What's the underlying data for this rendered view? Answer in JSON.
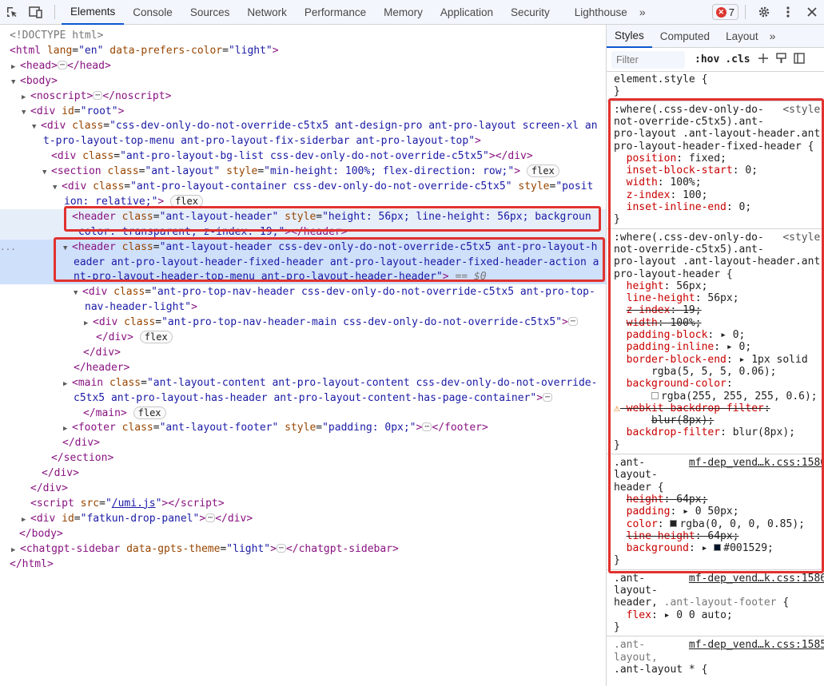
{
  "toolbar": {
    "tabs": [
      "Elements",
      "Console",
      "Sources",
      "Network",
      "Performance",
      "Memory",
      "Application",
      "Security",
      "Lighthouse"
    ],
    "more": "»",
    "error_count": "7",
    "icons": [
      "inspect-icon",
      "device-toggle-icon",
      "settings-icon",
      "kebab-menu-icon",
      "close-icon"
    ]
  },
  "dom": {
    "lines": [
      {
        "indent": 0,
        "tri": "",
        "html": "<span class=\"gray\">&lt;!DOCTYPE html&gt;</span>"
      },
      {
        "indent": 0,
        "tri": "",
        "html": "<span class=\"tag\">&lt;html</span> <span class=\"attr\">lang</span>=<span class=\"val\">\"en\"</span> <span class=\"attr\">data-prefers-color</span>=<span class=\"val\">\"light\"</span><span class=\"tag\">&gt;</span>"
      },
      {
        "indent": 1,
        "tri": "▶",
        "html": "<span class=\"tag\">&lt;head&gt;</span><span class=\"dots\">⋯</span><span class=\"tag\">&lt;/head&gt;</span>"
      },
      {
        "indent": 1,
        "tri": "▼",
        "html": "<span class=\"tag\">&lt;body&gt;</span>"
      },
      {
        "indent": 2,
        "tri": "▶",
        "html": "<span class=\"tag\">&lt;noscript&gt;</span><span class=\"dots\">⋯</span><span class=\"tag\">&lt;/noscript&gt;</span>"
      },
      {
        "indent": 2,
        "tri": "▼",
        "html": "<span class=\"tag\">&lt;div</span> <span class=\"attr\">id</span>=<span class=\"val\">\"root\"</span><span class=\"tag\">&gt;</span>"
      },
      {
        "indent": 3,
        "tri": "▼",
        "html": "<span class=\"tag\">&lt;div</span> <span class=\"attr\">class</span>=<span class=\"val\">\"css-dev-only-do-not-override-c5tx5 ant-design-pro ant-pro-layout screen-xl an</span>"
      },
      {
        "indent": 3,
        "tri": "",
        "raw_indent": 54,
        "html": "<span class=\"val\">t-pro-layout-top-menu ant-pro-layout-fix-siderbar ant-pro-layout-top\"</span><span class=\"tag\">&gt;</span>"
      },
      {
        "indent": 4,
        "tri": "",
        "html": "<span class=\"tag\">&lt;div</span> <span class=\"attr\">class</span>=<span class=\"val\">\"ant-pro-layout-bg-list css-dev-only-do-not-override-c5tx5\"</span><span class=\"tag\">&gt;&lt;/div&gt;</span>"
      },
      {
        "indent": 4,
        "tri": "▼",
        "html": "<span class=\"tag\">&lt;section</span> <span class=\"attr\">class</span>=<span class=\"val\">\"ant-layout\"</span> <span class=\"attr\">style</span>=<span class=\"val\">\"min-height: 100%; flex-direction: row;\"</span><span class=\"tag\">&gt;</span> <span class=\"pill\">flex</span>"
      },
      {
        "indent": 5,
        "tri": "▼",
        "html": "<span class=\"tag\">&lt;div</span> <span class=\"attr\">class</span>=<span class=\"val\">\"ant-pro-layout-container css-dev-only-do-not-override-c5tx5\"</span> <span class=\"attr\">style</span>=<span class=\"val\">\"posit</span>"
      },
      {
        "indent": 5,
        "tri": "",
        "raw_indent": 80,
        "html": "<span class=\"val\">ion: relative;\"</span><span class=\"tag\">&gt;</span> <span class=\"pill\">flex</span>"
      },
      {
        "indent": 6,
        "tri": "",
        "hov": true,
        "html": "<span class=\"tag\">&lt;header</span> <span class=\"attr\">class</span>=<span class=\"val\">\"ant-layout-header\"</span> <span class=\"attr\">style</span>=<span class=\"val\">\"height: 56px; line-height: 56px; backgroun</span>"
      },
      {
        "indent": 6,
        "tri": "",
        "hov": true,
        "raw_indent": 98,
        "html": "<span class=\"val\">color: transparent; z-index: 19;\"</span><span class=\"tag\">&gt;&lt;/header&gt;</span>"
      },
      {
        "indent": 6,
        "tri": "▼",
        "sel": true,
        "html": "<span class=\"tag\">&lt;header</span> <span class=\"attr\">class</span>=<span class=\"val\">\"ant-layout-header css-dev-only-do-not-override-c5tx5 ant-pro-layout-h</span>"
      },
      {
        "indent": 6,
        "tri": "",
        "sel": true,
        "raw_indent": 92,
        "html": "<span class=\"val\">eader ant-pro-layout-header-fixed-header ant-pro-layout-header-fixed-header-action a</span>"
      },
      {
        "indent": 6,
        "tri": "",
        "sel": true,
        "raw_indent": 92,
        "html": "<span class=\"val\">nt-pro-layout-header-top-menu ant-pro-layout-header-header\"</span><span class=\"tag\">&gt;</span> <span class=\"gray\">==</span> <span class=\"dollar\">$0</span>"
      },
      {
        "indent": 7,
        "tri": "▼",
        "html": "<span class=\"tag\">&lt;div</span> <span class=\"attr\">class</span>=<span class=\"val\">\"ant-pro-top-nav-header css-dev-only-do-not-override-c5tx5 ant-pro-top-</span>"
      },
      {
        "indent": 7,
        "tri": "",
        "raw_indent": 106,
        "html": "<span class=\"val\">nav-header-light\"</span><span class=\"tag\">&gt;</span>"
      },
      {
        "indent": 8,
        "tri": "▶",
        "html": "<span class=\"tag\">&lt;div</span> <span class=\"attr\">class</span>=<span class=\"val\">\"ant-pro-top-nav-header-main css-dev-only-do-not-override-c5tx5\"</span><span class=\"tag\">&gt;</span><span class=\"dots\">⋯</span>"
      },
      {
        "indent": 8,
        "tri": "",
        "raw_indent": 120,
        "html": "<span class=\"tag\">&lt;/div&gt;</span> <span class=\"pill\">flex</span>"
      },
      {
        "indent": 7,
        "tri": "",
        "raw_indent": 104,
        "html": "<span class=\"tag\">&lt;/div&gt;</span>"
      },
      {
        "indent": 6,
        "tri": "",
        "raw_indent": 92,
        "html": "<span class=\"tag\">&lt;/header&gt;</span>"
      },
      {
        "indent": 6,
        "tri": "▶",
        "html": "<span class=\"tag\">&lt;main</span> <span class=\"attr\">class</span>=<span class=\"val\">\"ant-layout-content ant-pro-layout-content css-dev-only-do-not-override-</span>"
      },
      {
        "indent": 6,
        "tri": "",
        "raw_indent": 92,
        "html": "<span class=\"val\">c5tx5 ant-pro-layout-has-header ant-pro-layout-content-has-page-container\"</span><span class=\"tag\">&gt;</span><span class=\"dots\">⋯</span>"
      },
      {
        "indent": 6,
        "tri": "",
        "raw_indent": 104,
        "html": "<span class=\"tag\">&lt;/main&gt;</span> <span class=\"pill\">flex</span>"
      },
      {
        "indent": 6,
        "tri": "▶",
        "html": "<span class=\"tag\">&lt;footer</span> <span class=\"attr\">class</span>=<span class=\"val\">\"ant-layout-footer\"</span> <span class=\"attr\">style</span>=<span class=\"val\">\"padding: 0px;\"</span><span class=\"tag\">&gt;</span><span class=\"dots\">⋯</span><span class=\"tag\">&lt;/footer&gt;</span>"
      },
      {
        "indent": 5,
        "tri": "",
        "raw_indent": 78,
        "html": "<span class=\"tag\">&lt;/div&gt;</span>"
      },
      {
        "indent": 4,
        "tri": "",
        "raw_indent": 64,
        "html": "<span class=\"tag\">&lt;/section&gt;</span>"
      },
      {
        "indent": 3,
        "tri": "",
        "raw_indent": 52,
        "html": "<span class=\"tag\">&lt;/div&gt;</span>"
      },
      {
        "indent": 2,
        "tri": "",
        "raw_indent": 38,
        "html": "<span class=\"tag\">&lt;/div&gt;</span>"
      },
      {
        "indent": 2,
        "tri": "",
        "raw_indent": 38,
        "html": "<span class=\"tag\">&lt;script</span> <span class=\"attr\">src</span>=<span class=\"val\">\"<span class=\"link\">/umi.js</span>\"</span><span class=\"tag\">&gt;&lt;/script&gt;</span>"
      },
      {
        "indent": 2,
        "tri": "▶",
        "html": "<span class=\"tag\">&lt;div</span> <span class=\"attr\">id</span>=<span class=\"val\">\"fatkun-drop-panel\"</span><span class=\"tag\">&gt;</span><span class=\"dots\">⋯</span><span class=\"tag\">&lt;/div&gt;</span>"
      },
      {
        "indent": 1,
        "tri": "",
        "raw_indent": 24,
        "html": "<span class=\"tag\">&lt;/body&gt;</span>"
      },
      {
        "indent": 1,
        "tri": "▶",
        "html": "<span class=\"tag\">&lt;chatgpt-sidebar</span> <span class=\"attr\">data-gpts-theme</span>=<span class=\"val\">\"light\"</span><span class=\"tag\">&gt;</span><span class=\"dots\">⋯</span><span class=\"tag\">&lt;/chatgpt-sidebar&gt;</span>"
      },
      {
        "indent": 0,
        "tri": "",
        "raw_indent": 12,
        "html": "<span class=\"tag\">&lt;/html&gt;</span>"
      }
    ],
    "ellipsis": "..."
  },
  "sidebar": {
    "tabs": [
      "Styles",
      "Computed",
      "Layout"
    ],
    "more": "»",
    "filter_placeholder": "Filter",
    "hov": ":hov",
    ".cls": ".cls",
    "lines": [
      {
        "html": "<span class=\"sel-txt\">element.style {</span>"
      },
      {
        "html": "<span class=\"sel-txt\">}</span>"
      },
      {
        "sep": true
      },
      {
        "html": "<span class=\"sel-txt\">:where(.css-dev-only-do-   </span><span class=\"style-src\">&lt;style</span>"
      },
      {
        "html": "<span class=\"sel-txt\">not-override-c5tx5).ant-</span>"
      },
      {
        "html": "<span class=\"sel-txt\">pro-layout .ant-layout-header.ant</span>"
      },
      {
        "html": "<span class=\"sel-txt\">pro-layout-header-fixed-header {</span>"
      },
      {
        "html": "  <span class=\"prop\">position</span>: <span class=\"pval\">fixed;</span>"
      },
      {
        "html": "  <span class=\"prop\">inset-block-start</span>: <span class=\"pval\">0;</span>"
      },
      {
        "html": "  <span class=\"prop\">width</span>: <span class=\"pval\">100%;</span>"
      },
      {
        "html": "  <span class=\"prop\">z-index</span>: <span class=\"pval\">100;</span>"
      },
      {
        "html": "  <span class=\"prop\">inset-inline-end</span>: <span class=\"pval\">0;</span>"
      },
      {
        "html": "<span class=\"sel-txt\">}</span>"
      },
      {
        "sep": true
      },
      {
        "html": "<span class=\"sel-txt\">:where(.css-dev-only-do-   </span><span class=\"style-src\">&lt;style</span>"
      },
      {
        "html": "<span class=\"sel-txt\">not-override-c5tx5).ant-</span>"
      },
      {
        "html": "<span class=\"sel-txt\">pro-layout .ant-layout-header.ant</span>"
      },
      {
        "html": "<span class=\"sel-txt\">pro-layout-header {</span>"
      },
      {
        "html": "  <span class=\"prop\">height</span>: <span class=\"pval\">56px;</span>"
      },
      {
        "html": "  <span class=\"prop\">line-height</span>: <span class=\"pval\">56px;</span>"
      },
      {
        "html": "  <span class=\"strike\"><span class=\"prop\">z-index</span>: <span class=\"pval\">19;</span></span>"
      },
      {
        "html": "  <span class=\"strike\"><span class=\"prop\">width</span>: <span class=\"pval\">100%;</span></span>"
      },
      {
        "html": "  <span class=\"prop\">padding-block</span>: <span class=\"pval\">▸ 0;</span>"
      },
      {
        "html": "  <span class=\"prop\">padding-inline</span>: <span class=\"pval\">▸ 0;</span>"
      },
      {
        "html": "  <span class=\"prop\">border-block-end</span>: <span class=\"pval\">▸ 1px solid</span>"
      },
      {
        "html": "      <span class=\"pval\">rgba(5, 5, 5, 0.06);</span>"
      },
      {
        "html": "  <span class=\"prop\">background-color</span>:"
      },
      {
        "html": "      <span class=\"swatch\" style=\"background:#fff\"></span><span class=\"pval\">rgba(255, 255, 255, 0.6);</span>"
      },
      {
        "html": "<span class=\"warn\">⚠</span><span class=\"strike\"><span class=\"prop\">-webkit-backdrop-filter</span>:</span>"
      },
      {
        "html": "      <span class=\"strike\"><span class=\"pval\">blur(8px);</span></span>"
      },
      {
        "html": "  <span class=\"prop\">backdrop-filter</span>: <span class=\"pval\">blur(8px);</span>"
      },
      {
        "html": "<span class=\"sel-txt\">}</span>"
      },
      {
        "sep": true
      },
      {
        "html": "<span class=\"sel-txt\">.ant-       </span><span class=\"srclink\">mf-dep_vend…k.css:1586</span>"
      },
      {
        "html": "<span class=\"sel-txt\">layout-</span>"
      },
      {
        "html": "<span class=\"sel-txt\">header {</span>"
      },
      {
        "html": "  <span class=\"strike\"><span class=\"prop\">height</span>: <span class=\"pval\">64px;</span></span>"
      },
      {
        "html": "  <span class=\"prop\">padding</span>: <span class=\"pval\">▸ 0 50px;</span>"
      },
      {
        "html": "  <span class=\"prop\">color</span>: <span class=\"swatch\" style=\"background:#222\"></span><span class=\"pval\">rgba(0, 0, 0, 0.85);</span>"
      },
      {
        "html": "  <span class=\"strike\"><span class=\"prop\">line-height</span>: <span class=\"pval\">64px;</span></span>"
      },
      {
        "html": "  <span class=\"prop\">background</span>: <span class=\"pval\">▸ <span class=\"swatch\" style=\"background:#001529\"></span>#001529;</span>"
      },
      {
        "html": "<span class=\"sel-txt\">}</span>"
      },
      {
        "sep": true
      },
      {
        "html": "<span class=\"sel-txt\">.ant-       </span><span class=\"srclink\">mf-dep_vend…k.css:1586</span>"
      },
      {
        "html": "<span class=\"sel-txt\">layout-</span>"
      },
      {
        "html": "<span class=\"sel-txt\">header, <span class=\"gray\">.ant-layout-footer</span> {</span>"
      },
      {
        "html": "  <span class=\"prop\">flex</span>: <span class=\"pval\">▸ 0 0 auto;</span>"
      },
      {
        "html": "<span class=\"sel-txt\">}</span>"
      },
      {
        "sep": true
      },
      {
        "html": "<span class=\"gray\">.ant-       </span><span class=\"srclink\">mf-dep_vend…k.css:1585</span>"
      },
      {
        "html": "<span class=\"gray\">layout,</span>"
      },
      {
        "html": "<span class=\"sel-txt\">.ant-layout * {</span>"
      }
    ]
  },
  "colors": {
    "highlight": "#e0322f",
    "selected_row": "#cfe0fb",
    "accent": "#0b57d0"
  }
}
